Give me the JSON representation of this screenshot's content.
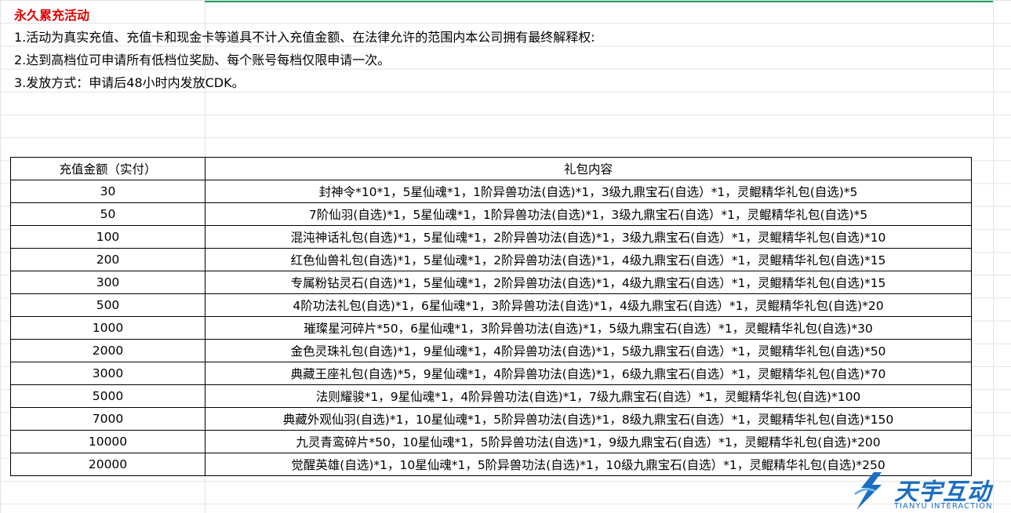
{
  "title": "永久累充活动",
  "notes": [
    "1.活动为真实充值、充值卡和现金卡等道具不计入充值金额、在法律允许的范围内本公司拥有最终解释权:",
    "2.达到高档位可申请所有低档位奖励、每个账号每档仅限申请一次。",
    "3.发放方式：申请后48小时内发放CDK。"
  ],
  "table": {
    "headers": [
      "充值金额（实付）",
      "礼包内容"
    ],
    "rows": [
      {
        "amount": "30",
        "content": "封神令*10*1，5星仙魂*1，1阶异兽功法(自选)*1，3级九鼎宝石(自选）*1，灵鲲精华礼包(自选)*5"
      },
      {
        "amount": "50",
        "content": "7阶仙羽(自选)*1，5星仙魂*1，1阶异兽功法(自选)*1，3级九鼎宝石(自选）*1，灵鲲精华礼包(自选)*5"
      },
      {
        "amount": "100",
        "content": "混沌神话礼包(自选)*1，5星仙魂*1，2阶异兽功法(自选)*1，3级九鼎宝石(自选）*1，灵鲲精华礼包(自选)*10"
      },
      {
        "amount": "200",
        "content": "红色仙兽礼包(自选)*1，5星仙魂*1，2阶异兽功法(自选)*1，4级九鼎宝石(自选）*1，灵鲲精华礼包(自选)*15"
      },
      {
        "amount": "300",
        "content": "专属粉钻灵石(自选)*1，5星仙魂*1，2阶异兽功法(自选)*1，4级九鼎宝石(自选）*1，灵鲲精华礼包(自选)*15"
      },
      {
        "amount": "500",
        "content": "4阶功法礼包(自选)*1，6星仙魂*1，3阶异兽功法(自选)*1，4级九鼎宝石(自选）*1，灵鲲精华礼包(自选)*20"
      },
      {
        "amount": "1000",
        "content": "璀璨星河碎片*50，6星仙魂*1，3阶异兽功法(自选)*1，5级九鼎宝石(自选）*1，灵鲲精华礼包(自选)*30"
      },
      {
        "amount": "2000",
        "content": "金色灵珠礼包(自选)*1，9星仙魂*1，4阶异兽功法(自选)*1，5级九鼎宝石(自选）*1，灵鲲精华礼包(自选)*50"
      },
      {
        "amount": "3000",
        "content": "典藏王座礼包(自选)*5，9星仙魂*1，4阶异兽功法(自选)*1，6级九鼎宝石(自选）*1，灵鲲精华礼包(自选)*70"
      },
      {
        "amount": "5000",
        "content": "法则耀骏*1，9星仙魂*1，4阶异兽功法(自选)*1，7级九鼎宝石(自选）*1，灵鲲精华礼包(自选)*100"
      },
      {
        "amount": "7000",
        "content": "典藏外观仙羽(自选)*1，10星仙魂*1，5阶异兽功法(自选)*1，8级九鼎宝石(自选）*1，灵鲲精华礼包(自选)*150"
      },
      {
        "amount": "10000",
        "content": "九灵青鸾碎片*50，10星仙魂*1，5阶异兽功法(自选)*1，9级九鼎宝石(自选）*1，灵鲲精华礼包(自选)*200"
      },
      {
        "amount": "20000",
        "content": "觉醒英雄(自选)*1，10星仙魂*1，5阶异兽功法(自选)*1，10级九鼎宝石(自选）*1，灵鲲精华礼包(自选)*250"
      }
    ]
  },
  "logo": {
    "name": "天宇互动",
    "sub": "TIANYU INTERACTION",
    "color": "#1b6ec2"
  },
  "colors": {
    "title": "#e00000",
    "selection_bar": "#1e9e60",
    "grid": "#e3e3e3"
  }
}
